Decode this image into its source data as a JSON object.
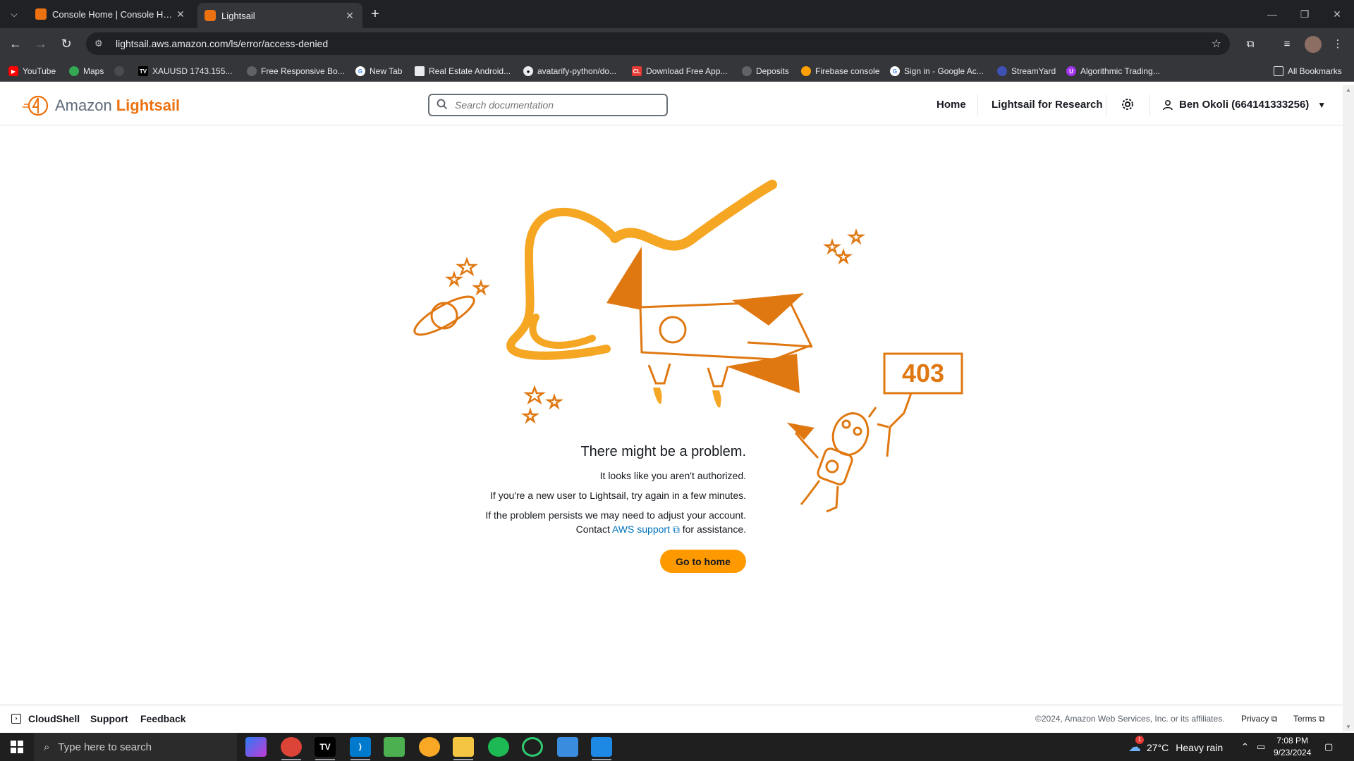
{
  "browser": {
    "tabs": [
      {
        "title": "Console Home | Console Home",
        "active": false
      },
      {
        "title": "Lightsail",
        "active": true
      }
    ],
    "url": "lightsail.aws.amazon.com/ls/error/access-denied",
    "bookmarks": [
      "YouTube",
      "Maps",
      "XAUUSD 1743.155...",
      "Free Responsive Bo...",
      "New Tab",
      "Real Estate Android...",
      "avatarify-python/do...",
      "Download Free App...",
      "Deposits",
      "Firebase console",
      "Sign in - Google Ac...",
      "StreamYard",
      "Algorithmic Trading..."
    ],
    "all_bookmarks": "All Bookmarks"
  },
  "header": {
    "logo_amazon": "Amazon",
    "logo_lightsail": "Lightsail",
    "search_placeholder": "Search documentation",
    "nav_home": "Home",
    "nav_research": "Lightsail for Research",
    "user": "Ben Okoli (664141333256)"
  },
  "error": {
    "code": "403",
    "headline": "There might be a problem.",
    "line1": "It looks like you aren't authorized.",
    "line2": "If you're a new user to Lightsail, try again in a few minutes.",
    "line3": "If the problem persists we may need to adjust your account.",
    "contact_prefix": "Contact",
    "contact_link": "AWS support",
    "contact_suffix": "for assistance.",
    "button": "Go to home"
  },
  "footer": {
    "cloudshell": "CloudShell",
    "support": "Support",
    "feedback": "Feedback",
    "copyright": "©2024, Amazon Web Services, Inc. or its affiliates.",
    "privacy": "Privacy",
    "terms": "Terms"
  },
  "taskbar": {
    "search_placeholder": "Type here to search",
    "weather_temp": "27°C",
    "weather_desc": "Heavy rain",
    "weather_badge": "1",
    "time": "7:08 PM",
    "date": "9/23/2024"
  },
  "colors": {
    "brand_orange": "#ec7211",
    "illustration_orange": "#e07812",
    "flame_orange": "#f5a623",
    "button_orange": "#ff9900",
    "link_blue": "#0073bb"
  }
}
